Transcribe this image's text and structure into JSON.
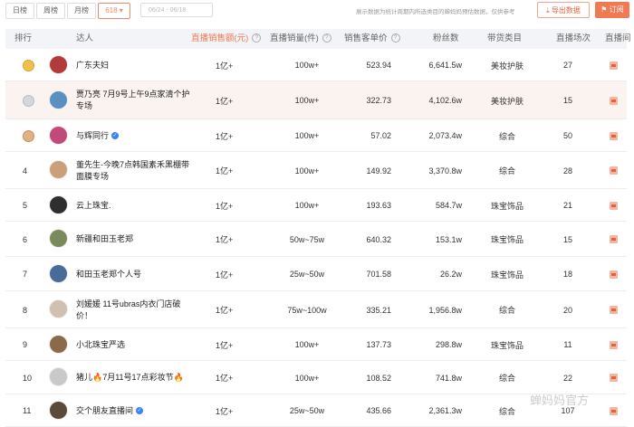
{
  "filters": {
    "tabs": [
      {
        "label": "日榜",
        "active": false
      },
      {
        "label": "周榜",
        "active": false
      },
      {
        "label": "月榜",
        "active": false
      },
      {
        "label": "618",
        "active": true
      }
    ],
    "date_placeholder": "06/24 - 06/18",
    "notice": "展示数据为统计周期内所选类目的蝉妈妈预估数据，仅供参考",
    "export_label": "导出数据",
    "subscribe_label": "订阅"
  },
  "table": {
    "columns": [
      "排行",
      "达人",
      "直播销售额(元)",
      "直播销量(件)",
      "销售客单价",
      "粉丝数",
      "带货类目",
      "直播场次",
      "直播间"
    ],
    "sorted_column": "直播销售额(元)",
    "rows": [
      {
        "rank": "",
        "medal": "gold",
        "name": "广东夫妇",
        "verified": false,
        "sales": "1亿+",
        "volume": "100w+",
        "price": "523.94",
        "fans": "6,641.5w",
        "category": "美妆护肤",
        "sessions": "27"
      },
      {
        "rank": "",
        "medal": "silver",
        "name": "贾乃亮 7月9号上午9点家清个护专场",
        "verified": false,
        "sales": "1亿+",
        "volume": "100w+",
        "price": "322.73",
        "fans": "4,102.6w",
        "category": "美妆护肤",
        "sessions": "15"
      },
      {
        "rank": "",
        "medal": "bronze",
        "name": "与辉同行",
        "verified": true,
        "sales": "1亿+",
        "volume": "100w+",
        "price": "57.02",
        "fans": "2,073.4w",
        "category": "综合",
        "sessions": "50"
      },
      {
        "rank": "4",
        "medal": "",
        "name": "董先生-今晚7点韩国素禾黑棚带面膜专场",
        "verified": false,
        "sales": "1亿+",
        "volume": "100w+",
        "price": "149.92",
        "fans": "3,370.8w",
        "category": "综合",
        "sessions": "28"
      },
      {
        "rank": "5",
        "medal": "",
        "name": "云上珠宝.",
        "verified": false,
        "sales": "1亿+",
        "volume": "100w+",
        "price": "193.63",
        "fans": "584.7w",
        "category": "珠宝饰品",
        "sessions": "21"
      },
      {
        "rank": "6",
        "medal": "",
        "name": "新疆和田玉老郑",
        "verified": false,
        "sales": "1亿+",
        "volume": "50w~75w",
        "price": "640.32",
        "fans": "153.1w",
        "category": "珠宝饰品",
        "sessions": "15"
      },
      {
        "rank": "7",
        "medal": "",
        "name": "和田玉老郑个人号",
        "verified": false,
        "sales": "1亿+",
        "volume": "25w~50w",
        "price": "701.58",
        "fans": "26.2w",
        "category": "珠宝饰品",
        "sessions": "18"
      },
      {
        "rank": "8",
        "medal": "",
        "name": "刘媛媛 11号ubras内衣门店破价！",
        "verified": false,
        "sales": "1亿+",
        "volume": "75w~100w",
        "price": "335.21",
        "fans": "1,956.8w",
        "category": "综合",
        "sessions": "20"
      },
      {
        "rank": "9",
        "medal": "",
        "name": "小北珠宝严选",
        "verified": false,
        "sales": "1亿+",
        "volume": "100w+",
        "price": "137.73",
        "fans": "298.8w",
        "category": "珠宝饰品",
        "sessions": "11"
      },
      {
        "rank": "10",
        "medal": "",
        "name": "猪儿🔥7月11号17点彩妆节🔥",
        "verified": false,
        "sales": "1亿+",
        "volume": "100w+",
        "price": "108.52",
        "fans": "741.8w",
        "category": "综合",
        "sessions": "22"
      },
      {
        "rank": "11",
        "medal": "",
        "name": "交个朋友直播间",
        "verified": true,
        "sales": "1亿+",
        "volume": "25w~50w",
        "price": "435.66",
        "fans": "2,361.3w",
        "category": "综合",
        "sessions": "107"
      }
    ]
  },
  "watermark": "蝉妈妈官方",
  "colors": {
    "accent": "#f07a52",
    "header_bg": "#f3f4f7",
    "highlight_row": "#fbf3f0"
  }
}
